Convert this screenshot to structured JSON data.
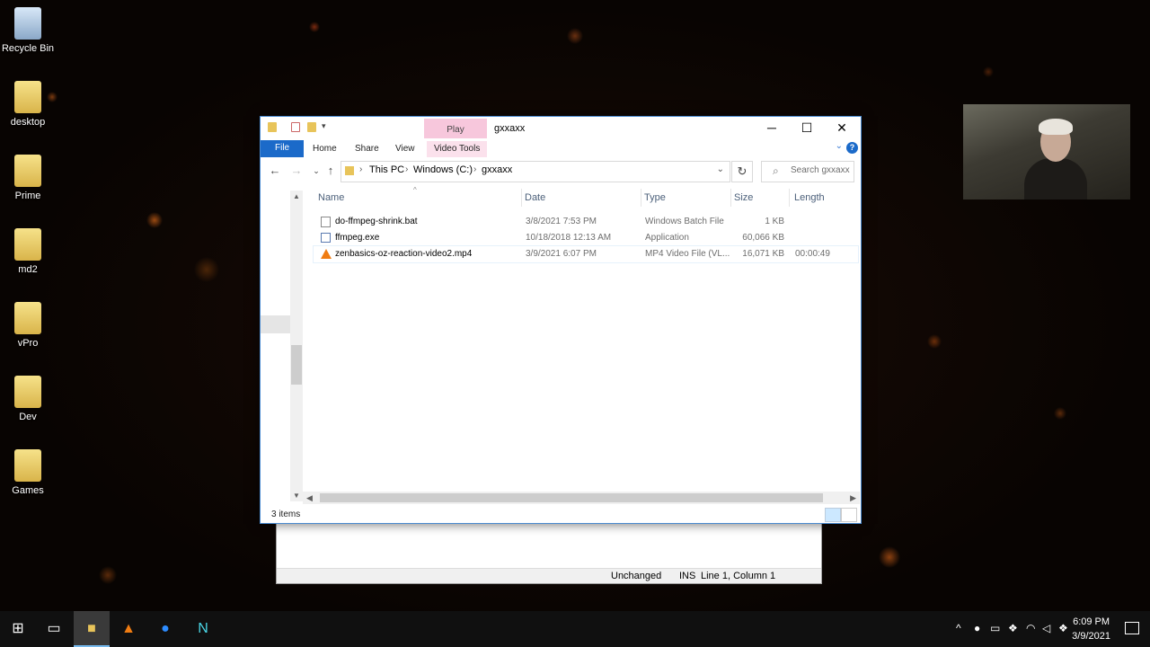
{
  "desktop": {
    "icons": [
      {
        "label": "Recycle Bin"
      },
      {
        "label": "desktop"
      },
      {
        "label": "Prime"
      },
      {
        "label": "md2"
      },
      {
        "label": "vPro"
      },
      {
        "label": "Dev"
      },
      {
        "label": "Games"
      }
    ]
  },
  "explorer": {
    "window_title": "gxxaxx",
    "contextual_tab": "Play",
    "ribbon_tabs": {
      "file": "File",
      "home": "Home",
      "share": "Share",
      "view": "View",
      "video_tools": "Video Tools"
    },
    "window_controls": {
      "minimize": "─",
      "maximize": "☐",
      "close": "✕"
    },
    "address": {
      "segments": [
        "This PC",
        "Windows (C:)",
        "gxxaxx"
      ]
    },
    "search_placeholder": "Search gxxaxx",
    "columns": {
      "name": "Name",
      "date": "Date",
      "type": "Type",
      "size": "Size",
      "length": "Length"
    },
    "files": [
      {
        "name": "do-ffmpeg-shrink.bat",
        "date": "3/8/2021 7:53 PM",
        "type": "Windows Batch File",
        "size": "1 KB",
        "length": "",
        "icon": "batch-file-icon"
      },
      {
        "name": "ffmpeg.exe",
        "date": "10/18/2018 12:13 AM",
        "type": "Application",
        "size": "60,066 KB",
        "length": "",
        "icon": "application-icon"
      },
      {
        "name": "zenbasics-oz-reaction-video2.mp4",
        "date": "3/9/2021 6:07 PM",
        "type": "MP4 Video File (VL...",
        "size": "16,071 KB",
        "length": "00:00:49",
        "icon": "vlc-video-icon"
      }
    ],
    "status": "3 items"
  },
  "notepad_status": {
    "encoding": "Unchanged",
    "mode": "INS",
    "position": "Line 1, Column 1"
  },
  "taskbar": {
    "time": "6:09 PM",
    "date": "3/9/2021"
  },
  "colors": {
    "accent": "#1b6ac9",
    "play_tab": "#f7c7dc",
    "taskbar": "#101010"
  }
}
